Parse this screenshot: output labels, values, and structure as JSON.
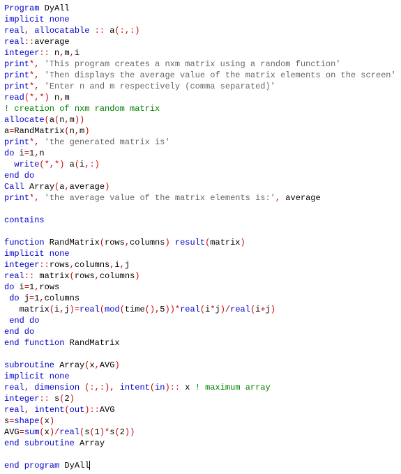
{
  "code": {
    "lines": [
      [
        [
          "kw",
          "Program"
        ],
        [
          "text",
          " DyAll"
        ]
      ],
      [
        [
          "kw",
          "implicit none"
        ]
      ],
      [
        [
          "kw",
          "real"
        ],
        [
          "punct",
          ","
        ],
        [
          "kw",
          " allocatable "
        ],
        [
          "punct",
          "::"
        ],
        [
          "text",
          " a"
        ],
        [
          "punct",
          "(:,:)"
        ]
      ],
      [
        [
          "kw",
          "real"
        ],
        [
          "punct",
          "::"
        ],
        [
          "text",
          "average"
        ]
      ],
      [
        [
          "kw",
          "integer"
        ],
        [
          "punct",
          "::"
        ],
        [
          "text",
          " n"
        ],
        [
          "punct",
          ","
        ],
        [
          "text",
          "m"
        ],
        [
          "punct",
          ","
        ],
        [
          "text",
          "i"
        ]
      ],
      [
        [
          "kw",
          "print"
        ],
        [
          "punct",
          "*, "
        ],
        [
          "str",
          "'This program creates a nxm matrix using a random function'"
        ]
      ],
      [
        [
          "kw",
          "print"
        ],
        [
          "punct",
          "*, "
        ],
        [
          "str",
          "'Then displays the average value of the matrix elements on the screen'"
        ]
      ],
      [
        [
          "kw",
          "print"
        ],
        [
          "punct",
          "*, "
        ],
        [
          "str",
          "'Enter n and m respectively (comma separated)'"
        ]
      ],
      [
        [
          "kw",
          "read"
        ],
        [
          "punct",
          "(*,*)"
        ],
        [
          "text",
          " n"
        ],
        [
          "punct",
          ","
        ],
        [
          "text",
          "m"
        ]
      ],
      [
        [
          "cmt",
          "! creation of nxm random matrix"
        ]
      ],
      [
        [
          "kw",
          "allocate"
        ],
        [
          "punct",
          "("
        ],
        [
          "text",
          "a"
        ],
        [
          "punct",
          "("
        ],
        [
          "text",
          "n"
        ],
        [
          "punct",
          ","
        ],
        [
          "text",
          "m"
        ],
        [
          "punct",
          "))"
        ]
      ],
      [
        [
          "text",
          "a"
        ],
        [
          "punct",
          "="
        ],
        [
          "text",
          "RandMatrix"
        ],
        [
          "punct",
          "("
        ],
        [
          "text",
          "n"
        ],
        [
          "punct",
          ","
        ],
        [
          "text",
          "m"
        ],
        [
          "punct",
          ")"
        ]
      ],
      [
        [
          "kw",
          "print"
        ],
        [
          "punct",
          "*, "
        ],
        [
          "str",
          "'the generated matrix is'"
        ]
      ],
      [
        [
          "kw",
          "do"
        ],
        [
          "text",
          " i"
        ],
        [
          "punct",
          "="
        ],
        [
          "text",
          "1"
        ],
        [
          "punct",
          ","
        ],
        [
          "text",
          "n"
        ]
      ],
      [
        [
          "text",
          "  "
        ],
        [
          "kw",
          "write"
        ],
        [
          "punct",
          "(*,*)"
        ],
        [
          "text",
          " a"
        ],
        [
          "punct",
          "("
        ],
        [
          "text",
          "i"
        ],
        [
          "punct",
          ",:)"
        ]
      ],
      [
        [
          "kw",
          "end do"
        ]
      ],
      [
        [
          "kw",
          "Call"
        ],
        [
          "text",
          " Array"
        ],
        [
          "punct",
          "("
        ],
        [
          "text",
          "a"
        ],
        [
          "punct",
          ","
        ],
        [
          "text",
          "average"
        ],
        [
          "punct",
          ")"
        ]
      ],
      [
        [
          "kw",
          "print"
        ],
        [
          "punct",
          "*, "
        ],
        [
          "str",
          "'the average value of the matrix elements is:'"
        ],
        [
          "punct",
          ","
        ],
        [
          "text",
          " average"
        ]
      ],
      [
        [
          "text",
          ""
        ]
      ],
      [
        [
          "kw",
          "contains"
        ]
      ],
      [
        [
          "text",
          ""
        ]
      ],
      [
        [
          "kw",
          "function"
        ],
        [
          "text",
          " RandMatrix"
        ],
        [
          "punct",
          "("
        ],
        [
          "text",
          "rows"
        ],
        [
          "punct",
          ","
        ],
        [
          "text",
          "columns"
        ],
        [
          "punct",
          ") "
        ],
        [
          "kw",
          "result"
        ],
        [
          "punct",
          "("
        ],
        [
          "text",
          "matrix"
        ],
        [
          "punct",
          ")"
        ]
      ],
      [
        [
          "kw",
          "implicit none"
        ]
      ],
      [
        [
          "kw",
          "integer"
        ],
        [
          "punct",
          "::"
        ],
        [
          "text",
          "rows"
        ],
        [
          "punct",
          ","
        ],
        [
          "text",
          "columns"
        ],
        [
          "punct",
          ","
        ],
        [
          "text",
          "i"
        ],
        [
          "punct",
          ","
        ],
        [
          "text",
          "j"
        ]
      ],
      [
        [
          "kw",
          "real"
        ],
        [
          "punct",
          "::"
        ],
        [
          "text",
          " matrix"
        ],
        [
          "punct",
          "("
        ],
        [
          "text",
          "rows"
        ],
        [
          "punct",
          ","
        ],
        [
          "text",
          "columns"
        ],
        [
          "punct",
          ")"
        ]
      ],
      [
        [
          "kw",
          "do"
        ],
        [
          "text",
          " i"
        ],
        [
          "punct",
          "="
        ],
        [
          "text",
          "1"
        ],
        [
          "punct",
          ","
        ],
        [
          "text",
          "rows"
        ]
      ],
      [
        [
          "text",
          " "
        ],
        [
          "kw",
          "do"
        ],
        [
          "text",
          " j"
        ],
        [
          "punct",
          "="
        ],
        [
          "text",
          "1"
        ],
        [
          "punct",
          ","
        ],
        [
          "text",
          "columns"
        ]
      ],
      [
        [
          "text",
          "   matrix"
        ],
        [
          "punct",
          "("
        ],
        [
          "text",
          "i"
        ],
        [
          "punct",
          ","
        ],
        [
          "text",
          "j"
        ],
        [
          "punct",
          ")="
        ],
        [
          "kw",
          "real"
        ],
        [
          "punct",
          "("
        ],
        [
          "kw",
          "mod"
        ],
        [
          "punct",
          "("
        ],
        [
          "text",
          "time"
        ],
        [
          "punct",
          "(),"
        ],
        [
          "text",
          "5"
        ],
        [
          "punct",
          "))*"
        ],
        [
          "kw",
          "real"
        ],
        [
          "punct",
          "("
        ],
        [
          "text",
          "i"
        ],
        [
          "punct",
          "*"
        ],
        [
          "text",
          "j"
        ],
        [
          "punct",
          ")/"
        ],
        [
          "kw",
          "real"
        ],
        [
          "punct",
          "("
        ],
        [
          "text",
          "i"
        ],
        [
          "punct",
          "+"
        ],
        [
          "text",
          "j"
        ],
        [
          "punct",
          ")"
        ]
      ],
      [
        [
          "text",
          " "
        ],
        [
          "kw",
          "end do"
        ]
      ],
      [
        [
          "kw",
          "end do"
        ]
      ],
      [
        [
          "kw",
          "end function"
        ],
        [
          "text",
          " RandMatrix"
        ]
      ],
      [
        [
          "text",
          ""
        ]
      ],
      [
        [
          "kw",
          "subroutine"
        ],
        [
          "text",
          " Array"
        ],
        [
          "punct",
          "("
        ],
        [
          "text",
          "x"
        ],
        [
          "punct",
          ","
        ],
        [
          "text",
          "AVG"
        ],
        [
          "punct",
          ")"
        ]
      ],
      [
        [
          "kw",
          "implicit none"
        ]
      ],
      [
        [
          "kw",
          "real"
        ],
        [
          "punct",
          ","
        ],
        [
          "kw",
          " dimension "
        ],
        [
          "punct",
          "(:,:),"
        ],
        [
          "kw",
          " intent"
        ],
        [
          "punct",
          "("
        ],
        [
          "kw",
          "in"
        ],
        [
          "punct",
          ")::"
        ],
        [
          "text",
          " x "
        ],
        [
          "cmt",
          "! maximum array"
        ]
      ],
      [
        [
          "kw",
          "integer"
        ],
        [
          "punct",
          "::"
        ],
        [
          "text",
          " s"
        ],
        [
          "punct",
          "("
        ],
        [
          "text",
          "2"
        ],
        [
          "punct",
          ")"
        ]
      ],
      [
        [
          "kw",
          "real"
        ],
        [
          "punct",
          ","
        ],
        [
          "kw",
          " intent"
        ],
        [
          "punct",
          "("
        ],
        [
          "kw",
          "out"
        ],
        [
          "punct",
          ")::"
        ],
        [
          "text",
          "AVG"
        ]
      ],
      [
        [
          "text",
          "s"
        ],
        [
          "punct",
          "="
        ],
        [
          "kw",
          "shape"
        ],
        [
          "punct",
          "("
        ],
        [
          "text",
          "x"
        ],
        [
          "punct",
          ")"
        ]
      ],
      [
        [
          "text",
          "AVG"
        ],
        [
          "punct",
          "="
        ],
        [
          "kw",
          "sum"
        ],
        [
          "punct",
          "("
        ],
        [
          "text",
          "x"
        ],
        [
          "punct",
          ")/"
        ],
        [
          "kw",
          "real"
        ],
        [
          "punct",
          "("
        ],
        [
          "text",
          "s"
        ],
        [
          "punct",
          "("
        ],
        [
          "text",
          "1"
        ],
        [
          "punct",
          ")*"
        ],
        [
          "text",
          "s"
        ],
        [
          "punct",
          "("
        ],
        [
          "text",
          "2"
        ],
        [
          "punct",
          "))"
        ]
      ],
      [
        [
          "kw",
          "end subroutine"
        ],
        [
          "text",
          " Array"
        ]
      ],
      [
        [
          "text",
          ""
        ]
      ],
      [
        [
          "kw",
          "end program"
        ],
        [
          "text",
          " DyAll"
        ]
      ]
    ],
    "cursor_line_index": 41
  }
}
